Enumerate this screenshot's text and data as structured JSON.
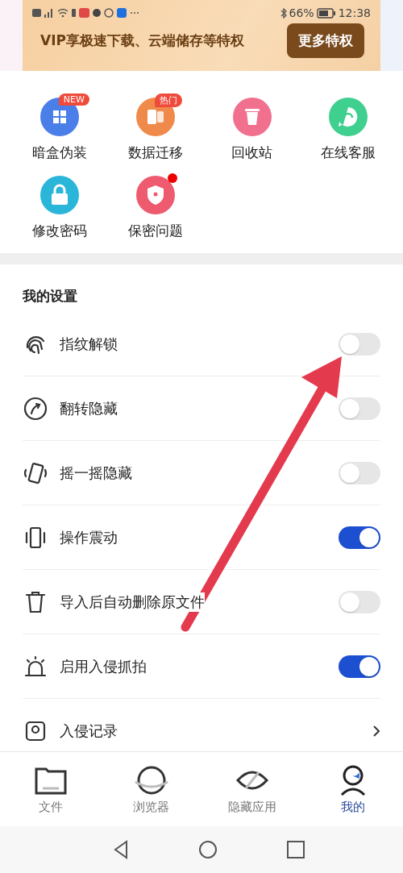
{
  "status_bar": {
    "battery": "66%",
    "time": "12:38"
  },
  "vip_banner": {
    "text": "VIP享极速下载、云端储存等特权",
    "button": "更多特权"
  },
  "tools": [
    {
      "label": "暗盒伪装",
      "badge": "NEW",
      "dot": false,
      "color": "#4a7ee8"
    },
    {
      "label": "数据迁移",
      "badge": "热门",
      "dot": false,
      "color": "#f08a4a"
    },
    {
      "label": "回收站",
      "dot": false,
      "color": "#f0708e"
    },
    {
      "label": "在线客服",
      "dot": false,
      "color": "#3fcf8e"
    },
    {
      "label": "修改密码",
      "dot": false,
      "color": "#2ab6d8"
    },
    {
      "label": "保密问题",
      "dot": true,
      "color": "#ee5a6e"
    }
  ],
  "settings": {
    "title": "我的设置",
    "items": [
      {
        "label": "指纹解锁",
        "kind": "toggle",
        "on": false
      },
      {
        "label": "翻转隐藏",
        "kind": "toggle",
        "on": false
      },
      {
        "label": "摇一摇隐藏",
        "kind": "toggle",
        "on": false
      },
      {
        "label": "操作震动",
        "kind": "toggle",
        "on": true
      },
      {
        "label": "导入后自动删除原文件",
        "kind": "toggle",
        "on": false
      },
      {
        "label": "启用入侵抓拍",
        "kind": "toggle",
        "on": true
      },
      {
        "label": "入侵记录",
        "kind": "link"
      }
    ]
  },
  "bottom_nav": [
    {
      "label": "文件",
      "selected": false
    },
    {
      "label": "浏览器",
      "selected": false
    },
    {
      "label": "隐藏应用",
      "selected": false
    },
    {
      "label": "我的",
      "selected": true
    }
  ]
}
